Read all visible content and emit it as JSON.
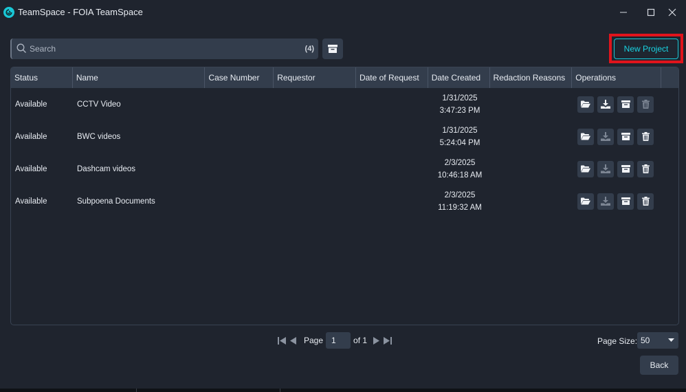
{
  "window": {
    "title": "TeamSpace - FOIA TeamSpace",
    "controls": [
      "minimize",
      "maximize",
      "close"
    ]
  },
  "toolbar": {
    "search_placeholder": "Search",
    "search_value": "",
    "search_count": "(4)",
    "archive_filter_icon": "archive-box-icon",
    "new_project_label": "New Project"
  },
  "colors": {
    "accent": "#19c7d6",
    "highlight": "#e0141c",
    "panel": "#333d4c",
    "background": "#1f242e"
  },
  "table": {
    "columns": [
      "Status",
      "Name",
      "Case Number",
      "Requestor",
      "Date of Request",
      "Date Created",
      "Redaction Reasons",
      "Operations"
    ],
    "rows": [
      {
        "status": "Available",
        "name": "CCTV Video",
        "case_number": "",
        "requestor": "",
        "date_of_request": "",
        "date_created": "1/31/2025",
        "time_created": "3:47:23 PM",
        "redaction_reasons": "",
        "download_enabled": true,
        "delete_enabled": false
      },
      {
        "status": "Available",
        "name": "BWC videos",
        "case_number": "",
        "requestor": "",
        "date_of_request": "",
        "date_created": "1/31/2025",
        "time_created": "5:24:04 PM",
        "redaction_reasons": "",
        "download_enabled": false,
        "delete_enabled": true
      },
      {
        "status": "Available",
        "name": "Dashcam videos",
        "case_number": "",
        "requestor": "",
        "date_of_request": "",
        "date_created": "2/3/2025",
        "time_created": "10:46:18 AM",
        "redaction_reasons": "",
        "download_enabled": false,
        "delete_enabled": true
      },
      {
        "status": "Available",
        "name": "Subpoena Documents",
        "case_number": "",
        "requestor": "",
        "date_of_request": "",
        "date_created": "2/3/2025",
        "time_created": "11:19:32 AM",
        "redaction_reasons": "",
        "download_enabled": false,
        "delete_enabled": true
      }
    ],
    "operations": [
      "open-folder-icon",
      "download-icon",
      "archive-icon",
      "trash-icon"
    ]
  },
  "pagination": {
    "page_label": "Page",
    "current_page": "1",
    "of_label": "of 1",
    "page_size_label": "Page Size:",
    "page_size": "50"
  },
  "footer": {
    "back_label": "Back"
  }
}
